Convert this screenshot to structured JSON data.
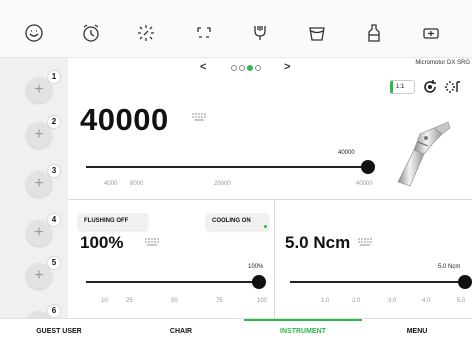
{
  "top_icons": [
    "smile-face-icon",
    "alarm-clock-icon",
    "sun-light-icon",
    "headset-icon",
    "spray-icon",
    "cup-icon",
    "bottle-icon",
    "battery-icon"
  ],
  "sidebar": {
    "programs": [
      {
        "num": "1",
        "plus": "+"
      },
      {
        "num": "2",
        "plus": "+"
      },
      {
        "num": "3",
        "plus": "+"
      },
      {
        "num": "4",
        "plus": "+"
      },
      {
        "num": "5",
        "plus": "+"
      },
      {
        "num": "6",
        "plus": "+"
      }
    ]
  },
  "pager": {
    "prev": "<",
    "next": ">",
    "pages": 4,
    "active_page": 3
  },
  "motor_model": "Micromotor DX SRG",
  "speed": {
    "value": "40000",
    "slider_value_label": "40000",
    "ticks": [
      "4000",
      "8000",
      "20000",
      "40000"
    ],
    "level_fraction": 1.0
  },
  "ratio": {
    "label": "1:1"
  },
  "flushing": {
    "button_label": "FLUSHING OFF",
    "cooling_button_label": "COOLING ON",
    "value": "100%",
    "slider_value_label": "100%",
    "ticks": [
      "10",
      "25",
      "50",
      "75",
      "100"
    ],
    "level_fraction": 1.0
  },
  "torque": {
    "value": "5.0 Ncm",
    "slider_value_label": "5.0 Ncm",
    "ticks": [
      "1.0",
      "2.0",
      "3.0",
      "4.0",
      "5.0"
    ],
    "level_fraction": 1.0
  },
  "bottom_nav": {
    "guest_user": "GUEST USER",
    "chair": "CHAIR",
    "instrument": "INSTRUMENT",
    "menu": "MENU",
    "active": "INSTRUMENT"
  },
  "colors": {
    "accent": "#2db84d",
    "background": "#ffffff",
    "sidebar": "#f0f0f0"
  }
}
